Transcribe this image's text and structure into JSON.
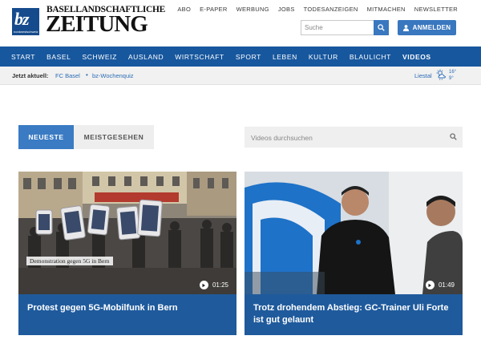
{
  "header": {
    "logo_text": "bz",
    "logo_sub": "nordwestschweiz",
    "brand_line1": "BASELLANDSCHAFTLICHE",
    "brand_line2": "ZEITUNG",
    "top_links": [
      "ABO",
      "E-PAPER",
      "WERBUNG",
      "JOBS",
      "TODESANZEIGEN",
      "MITMACHEN",
      "NEWSLETTER"
    ],
    "search_placeholder": "Suche",
    "login_label": "ANMELDEN"
  },
  "nav": {
    "items": [
      "START",
      "BASEL",
      "SCHWEIZ",
      "AUSLAND",
      "WIRTSCHAFT",
      "SPORT",
      "LEBEN",
      "KULTUR",
      "BLAULICHT",
      "VIDEOS"
    ],
    "active": "VIDEOS"
  },
  "subbar": {
    "label": "Jetzt aktuell:",
    "links": [
      "FC Basel",
      "bz-Wochenquiz"
    ],
    "separator": "•",
    "weather_city": "Liestal",
    "temp_high": "16°",
    "temp_low": "9°"
  },
  "videos": {
    "tab_active": "NEUESTE",
    "tab_other": "MEISTGESEHEN",
    "search_placeholder": "Videos durchsuchen",
    "items": [
      {
        "title": "Protest gegen 5G-Mobilfunk in Bern",
        "duration": "01:25",
        "caption": "Demonstration gegen 5G in Bern"
      },
      {
        "title": "Trotz drohendem Abstieg: GC-Trainer Uli Forte ist gut gelaunt",
        "duration": "01:49"
      }
    ]
  },
  "colors": {
    "nav_blue": "#17579e",
    "accent_blue": "#3977bf",
    "card_blue": "#1f5a9c"
  }
}
